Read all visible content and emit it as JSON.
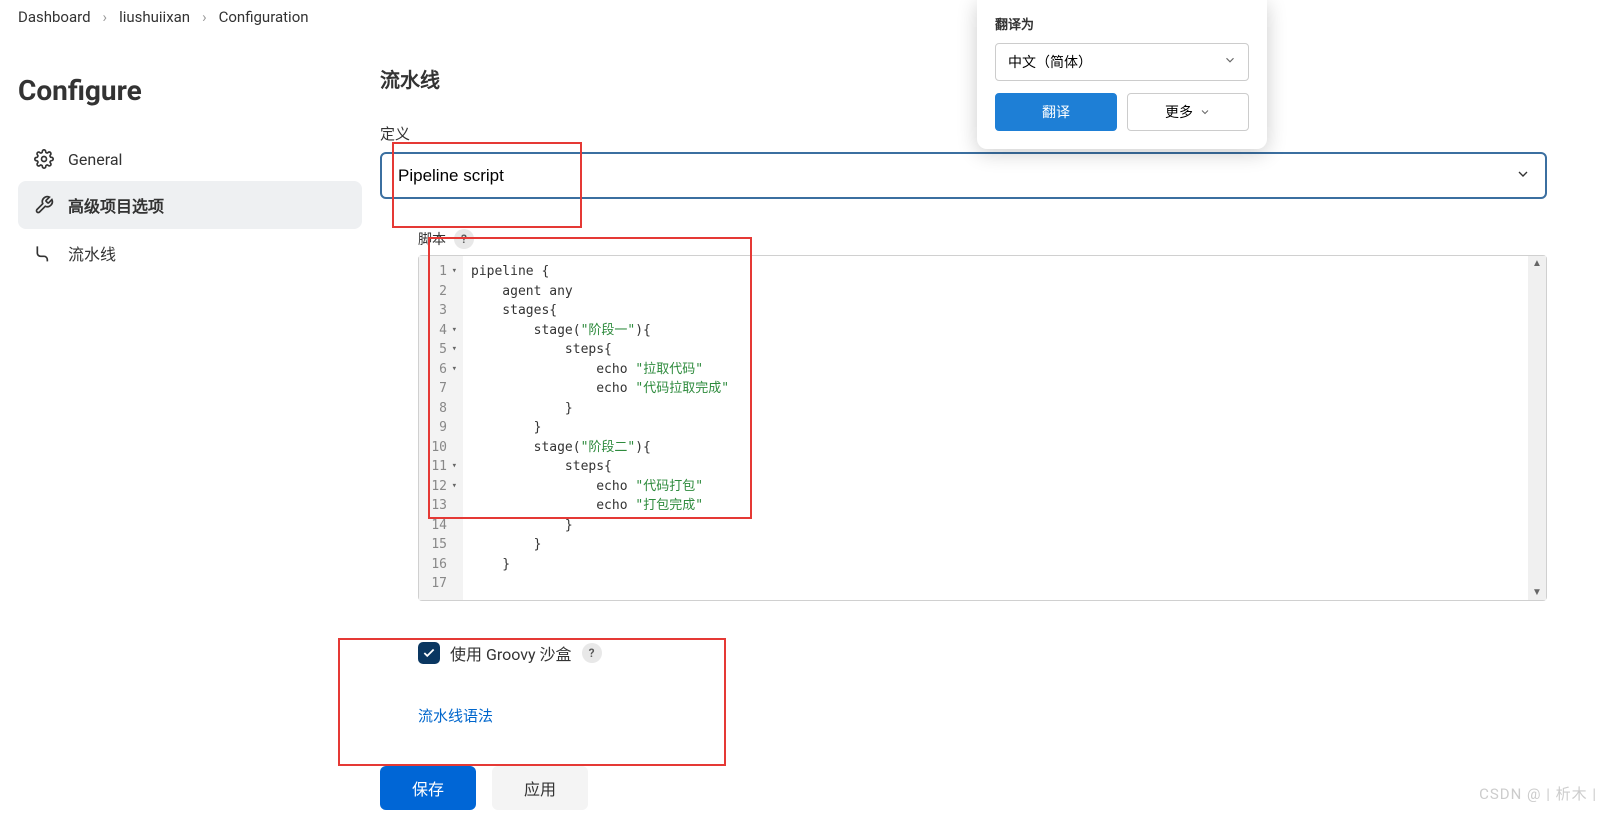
{
  "breadcrumb": {
    "items": [
      "Dashboard",
      "liushuiixan",
      "Configuration"
    ]
  },
  "page_title": "Configure",
  "sidebar": {
    "items": [
      {
        "label": "General",
        "icon": "gear-icon"
      },
      {
        "label": "高级项目选项",
        "icon": "wrench-icon"
      },
      {
        "label": "流水线",
        "icon": "pipeline-icon"
      }
    ]
  },
  "section": {
    "title": "流水线",
    "definition_label": "定义",
    "definition_value": "Pipeline script"
  },
  "script": {
    "label": "脚本",
    "lines": [
      "pipeline {",
      "    agent any",
      "",
      "    stages{",
      "        stage(\"阶段一\"){",
      "            steps{",
      "                echo \"拉取代码\"",
      "                echo \"代码拉取完成\"",
      "            }",
      "        }",
      "        stage(\"阶段二\"){",
      "            steps{",
      "                echo \"代码打包\"",
      "                echo \"打包完成\"",
      "            }",
      "        }",
      "    }"
    ],
    "fold_lines": [
      1,
      4,
      5,
      6,
      11,
      12
    ]
  },
  "sandbox": {
    "label": "使用 Groovy 沙盒",
    "checked": true
  },
  "syntax_link": "流水线语法",
  "buttons": {
    "save": "保存",
    "apply": "应用"
  },
  "translate": {
    "title": "翻译为",
    "selected": "中文（简体）",
    "translate_btn": "翻译",
    "more_btn": "更多"
  },
  "watermark": "CSDN @ | 析木 |"
}
